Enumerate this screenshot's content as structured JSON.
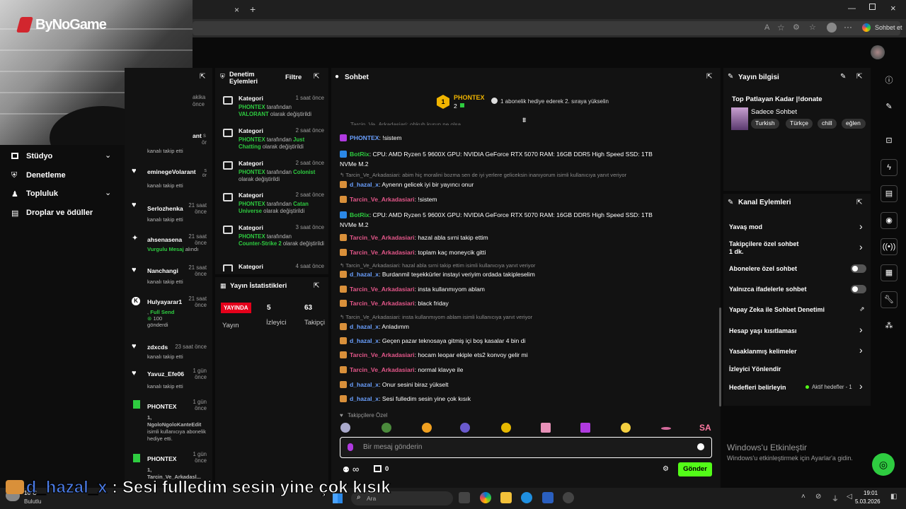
{
  "browser": {
    "new_tab": "+",
    "tab_close": "×",
    "read_aloud": "A",
    "sign_in": "Sohbet et"
  },
  "branding": {
    "logo": "ByNoGame"
  },
  "sidebar": {
    "items": [
      {
        "label": "Stüdyo"
      },
      {
        "label": "Denetleme"
      },
      {
        "label": "Topluluk"
      },
      {
        "label": "Droplar ve ödüller"
      }
    ]
  },
  "activity": {
    "partial_top": [
      "akika",
      "önce",
      "ant",
      "s",
      "ör"
    ],
    "events": [
      {
        "name": "",
        "time": "",
        "sub": "kanalı takip etti"
      },
      {
        "name": "eminegeVolarant",
        "time": "s ör",
        "sub": "kanalı takip etti"
      },
      {
        "name": "Serlozhenka",
        "time": "21 saat önce",
        "sub": "kanalı takip etti"
      },
      {
        "name": "ahsenasena",
        "time": "21 saat önce",
        "sub_a": "Vurgulu Mesaj",
        "sub_b": "alındı"
      },
      {
        "name": "Nanchangi",
        "time": "21 saat önce",
        "sub": "kanalı takip etti"
      },
      {
        "name": "Hulyayarar1",
        "time": "21 saat önce",
        "sub_a": "Full Send",
        "sub_prefix": ",",
        "count": "100",
        "sub_b": "gönderdi"
      },
      {
        "name": "zdxcds",
        "time": "23 saat önce",
        "sub": "kanalı takip etti"
      },
      {
        "name": "Yavuz_Efe06",
        "time": "1 gün önce",
        "sub": "kanalı takip etti"
      },
      {
        "name": "PHONTEX",
        "time": "1 gün önce",
        "sub_a": "1, NgoloNgoloKanteEdit",
        "sub_b": "isimli kullanıcıya abonelik hediye etti."
      },
      {
        "name": "PHONTEX",
        "time": "1 gün önce",
        "sub_a": "1, Tarcin_Ve_Arkadasl..."
      }
    ]
  },
  "moderation": {
    "title": "Denetim Eylemleri",
    "filter": "Filtre",
    "items": [
      {
        "title": "Kategori",
        "time": "1 saat önce",
        "actor": "PHONTEX",
        "mid": "tarafından",
        "value": "VALORANT",
        "tail": "olarak değiştirildi"
      },
      {
        "title": "Kategori",
        "time": "2 saat önce",
        "actor": "PHONTEX",
        "mid": "tarafından",
        "value": "Just Chatting",
        "tail": "olarak değiştirildi"
      },
      {
        "title": "Kategori",
        "time": "2 saat önce",
        "actor": "PHONTEX",
        "mid": "tarafından",
        "value": "Colonist",
        "tail": "olarak değiştirildi"
      },
      {
        "title": "Kategori",
        "time": "2 saat önce",
        "actor": "PHONTEX",
        "mid": "tarafından",
        "value": "Catan Universe",
        "tail": "olarak değiştirildi"
      },
      {
        "title": "Kategori",
        "time": "3 saat önce",
        "actor": "PHONTEX",
        "mid": "tarafından",
        "value": "Counter-Strike 2",
        "tail": "olarak değiştirildi"
      },
      {
        "title": "Kategori",
        "time": "4 saat önce"
      }
    ]
  },
  "stats": {
    "title": "Yayın İstatistikleri",
    "live_badge": "YAYINDA",
    "col1_value": "5",
    "col2_value": "63",
    "col1_label": "Yayın",
    "col2_label": "İzleyici",
    "col3_label": "Takipçi"
  },
  "chat": {
    "title": "Sohbet",
    "top_user": "PHONTEX",
    "top_rank": "1",
    "top_count": "2",
    "top_note": "1 abonelik hediye ederek 2. sıraya yükselin",
    "partial_top": "Tarcin_Ve_Arkadasiari: ohkuh kurun ne olsa",
    "messages": [
      {
        "type": "msg",
        "user": "PHONTEX",
        "ucolor": "#6aa0ff",
        "text": "!sistem"
      },
      {
        "type": "msg",
        "user": "BotRix",
        "ucolor": "#2ecc40",
        "text": "CPU: AMD Ryzen 5 9600X  GPU: NVIDIA GeForce RTX 5070  RAM: 16GB DDR5 High Speed  SSD: 1TB",
        "text2": "NVMe M.2"
      },
      {
        "type": "reply",
        "text": "Tarcin_Ve_Arkadasiari: abim hiç moralini bozma sen de iyi yerlere geliceksin inanıyorum isimli kullanıcıya yanıt veriyor"
      },
      {
        "type": "msg",
        "user": "d_hazal_x",
        "ucolor": "#6aa0ff",
        "text": "Aynenn gelicek iyi bir yayıncı onur"
      },
      {
        "type": "msg",
        "user": "Tarcin_Ve_Arkadasiari",
        "ucolor": "#e4578a",
        "text": "!sistem"
      },
      {
        "type": "msg",
        "user": "BotRix",
        "ucolor": "#2ecc40",
        "text": "CPU: AMD Ryzen 5 9600X  GPU: NVIDIA GeForce RTX 5070  RAM: 16GB DDR5 High Speed  SSD: 1TB",
        "text2": "NVMe M.2"
      },
      {
        "type": "msg",
        "user": "Tarcin_Ve_Arkadasiari",
        "ucolor": "#e4578a",
        "text": "hazal abla sırni takip ettim"
      },
      {
        "type": "msg",
        "user": "Tarcin_Ve_Arkadasiari",
        "ucolor": "#e4578a",
        "text": "toplam kaç moneycik gitti"
      },
      {
        "type": "reply",
        "text": "Tarcin_Ve_Arkadasiari: hazal abla sırni takip ettim isimli kullanıcıya yanıt veriyor"
      },
      {
        "type": "msg",
        "user": "d_hazal_x",
        "ucolor": "#6aa0ff",
        "text": "Burdanmil teşekkürler instayi veriyim ordada takipleselim"
      },
      {
        "type": "msg",
        "user": "Tarcin_Ve_Arkadasiari",
        "ucolor": "#e4578a",
        "text": "insta kullanmıyom ablam"
      },
      {
        "type": "msg",
        "user": "Tarcin_Ve_Arkadasiari",
        "ucolor": "#e4578a",
        "text": "black friday"
      },
      {
        "type": "reply",
        "text": "Tarcin_Ve_Arkadasiari: insta kullanmıyom ablam isimli kullanıcıya yanıt veriyor"
      },
      {
        "type": "msg",
        "user": "d_hazal_x",
        "ucolor": "#6aa0ff",
        "text": "Anladımm"
      },
      {
        "type": "msg",
        "user": "d_hazal_x",
        "ucolor": "#6aa0ff",
        "text": "Geçen pazar teknosaya gitmiş içi boş kasalar 4 bin di"
      },
      {
        "type": "msg",
        "user": "Tarcin_Ve_Arkadasiari",
        "ucolor": "#e4578a",
        "text": "hocam leopar ekiple ets2 konvoy gelir mi"
      },
      {
        "type": "msg",
        "user": "Tarcin_Ve_Arkadasiari",
        "ucolor": "#e4578a",
        "text": "normal klavye ile"
      },
      {
        "type": "msg",
        "user": "d_hazal_x",
        "ucolor": "#6aa0ff",
        "text": "Onur sesini biraz yükselt"
      },
      {
        "type": "msg",
        "user": "d_hazal_x",
        "ucolor": "#6aa0ff",
        "text": "Sesi fulledim sesin yine çok kısık"
      }
    ],
    "followers_only": "Takipçilere Özel",
    "emote_text": "SA",
    "input_placeholder": "Bir mesaj gönderin",
    "infinity": "∞",
    "store_count": "0",
    "send": "Gönder"
  },
  "stream_info": {
    "title": "Yayın bilgisi",
    "stream_title": "Top Patlayan Kadar |!donate",
    "category": "Sadece Sohbet",
    "tags": [
      "Turkish",
      "Türkçe",
      "chill",
      "eğlen"
    ]
  },
  "channel_actions": {
    "title": "Kanal Eylemleri",
    "items": [
      {
        "label": "Yavaş mod",
        "kind": "chevron"
      },
      {
        "label": "Takipçilere özel sohbet",
        "sub": "1 dk.",
        "kind": "chevron"
      },
      {
        "label": "Abonelere özel sohbet",
        "kind": "toggle"
      },
      {
        "label": "Yalnızca ifadelerle sohbet",
        "kind": "toggle"
      },
      {
        "label": "Yapay Zeka ile Sohbet Denetimi",
        "kind": "external"
      },
      {
        "label": "Hesap yaşı kısıtlaması",
        "kind": "chevron"
      },
      {
        "label": "Yasaklanmış kelimeler",
        "kind": "chevron"
      },
      {
        "label": "İzleyici Yönlendir",
        "kind": "none"
      },
      {
        "label": "Hedefleri belirleyin",
        "status": "Aktif hedefler - 1",
        "kind": "chevron"
      }
    ]
  },
  "watermark": {
    "line1": "Windows'u Etkinleştir",
    "line2": "Windows'u etkinleştirmek için Ayarlar'a gidin."
  },
  "caption": {
    "user": "d_hazal_x",
    "sep": " : ",
    "text": "Sesi fulledim sesin yine çok kısık"
  },
  "taskbar": {
    "temp": "16°C",
    "weather": "Bulutlu",
    "search": "Ara",
    "time": "19:01",
    "date": "5.03.2026"
  },
  "colors": {
    "accent": "#53fc18",
    "live": "#e4001b",
    "bg": "#0a0a0a",
    "panel": "#121212"
  }
}
